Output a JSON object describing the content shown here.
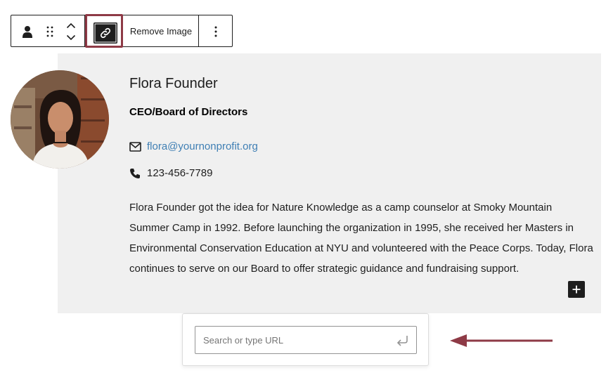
{
  "toolbar": {
    "remove_image_label": "Remove Image",
    "icons": [
      "person-icon",
      "drag-handle-icon",
      "chevron-up-icon",
      "chevron-down-icon",
      "link-icon",
      "more-vertical-icon"
    ],
    "highlight_color": "#8e3a46"
  },
  "profile": {
    "name": "Flora Founder",
    "role": "CEO/Board of Directors",
    "email": "flora@yournonprofit.org",
    "phone": "123-456-7789",
    "bio": "Flora Founder got the idea for Nature Knowledge as a camp counselor at Smoky Mountain Summer Camp in 1992. Before launching the organization in 1995, she received her Masters in Environmental Conservation Education at NYU and volunteered with the Peace Corps. Today, Flora continues to serve on our Board to offer strategic guidance and fundraising support.",
    "icons": [
      "envelope-icon",
      "phone-icon",
      "plus-icon"
    ]
  },
  "link_popover": {
    "placeholder": "Search or type URL",
    "value": "",
    "icons": [
      "enter-return-icon"
    ]
  },
  "colors": {
    "card_background": "#f0f0f0",
    "link_color": "#3f7fb4",
    "arrow_color": "#8e3a46",
    "dark": "#1e1e1e"
  }
}
